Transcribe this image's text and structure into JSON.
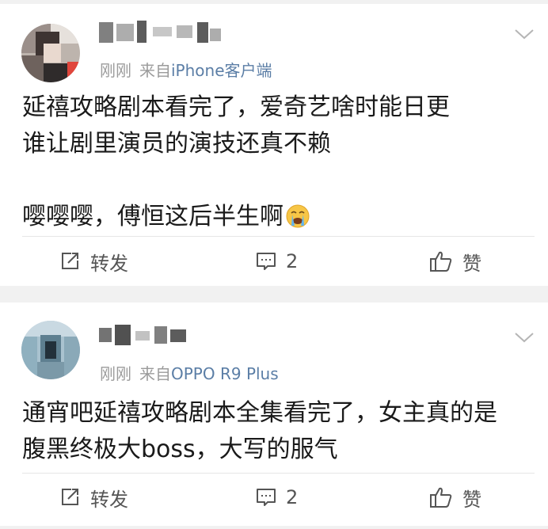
{
  "posts": [
    {
      "time": "刚刚",
      "source_prefix": "来自",
      "source": "iPhone客户端",
      "content_lines": [
        "延禧攻略剧本看完了，爱奇艺啥时能日更",
        "谁让剧里演员的演技还真不赖",
        "",
        "嘤嘤嘤，傅恒这后半生啊"
      ],
      "content_emoji": "crying-face",
      "actions": {
        "repost": "转发",
        "comment_count": "2",
        "like": "赞"
      }
    },
    {
      "time": "刚刚",
      "source_prefix": "来自",
      "source": "OPPO R9 Plus",
      "content_lines": [
        "通宵吧延禧攻略剧本全集看完了，女主真的是",
        "腹黑终极大boss，大写的服气"
      ],
      "actions": {
        "repost": "转发",
        "comment_count": "2",
        "like": "赞"
      }
    }
  ],
  "colors": {
    "source_link": "#5b7ea6",
    "meta_gray": "#9b9b9b",
    "separator": "#f1f1f1",
    "icon_gray": "#555555"
  },
  "icons": {
    "more": "chevron-down-icon",
    "repost": "repost-icon",
    "comment": "comment-icon",
    "like": "thumbs-up-icon"
  }
}
